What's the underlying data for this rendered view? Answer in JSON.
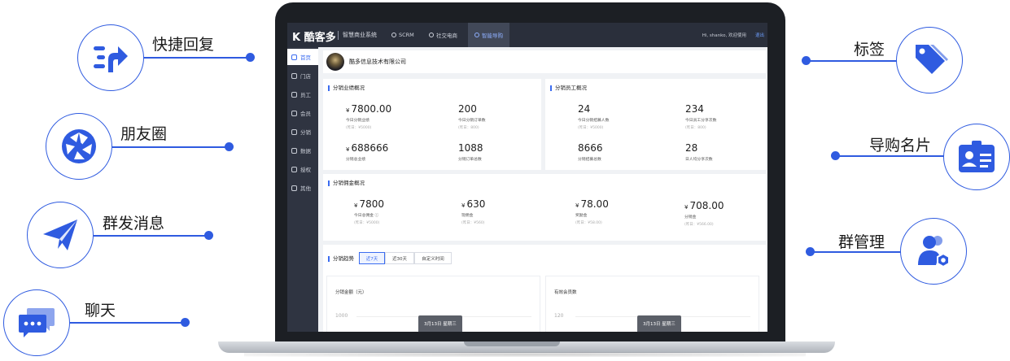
{
  "features": {
    "quick_reply": "快捷回复",
    "moments": "朋友圈",
    "mass_message": "群发消息",
    "chat": "聊天",
    "tags": "标签",
    "guide_card": "导购名片",
    "group_manage": "群管理"
  },
  "colors": {
    "accent": "#2f5be0",
    "topbar": "#2a2f3b",
    "sidebar": "#2f3441",
    "link": "#3b6cf0"
  },
  "app": {
    "logo": "酷客多",
    "system_name": "智慧商业系统",
    "nav": [
      {
        "label": "SCRM",
        "icon": "scrm-icon"
      },
      {
        "label": "社交电商",
        "icon": "shop-icon"
      },
      {
        "label": "智能导购",
        "icon": "guide-icon"
      }
    ],
    "welcome": "Hi, shanko, 欢迎使用",
    "logout": "退出"
  },
  "sidebar": [
    {
      "label": "首页",
      "icon": "home-icon"
    },
    {
      "label": "门店",
      "icon": "store-icon"
    },
    {
      "label": "员工",
      "icon": "staff-icon"
    },
    {
      "label": "会员",
      "icon": "member-icon"
    },
    {
      "label": "分销",
      "icon": "distribution-icon"
    },
    {
      "label": "数据",
      "icon": "data-icon"
    },
    {
      "label": "授权",
      "icon": "auth-icon"
    },
    {
      "label": "其他",
      "icon": "other-icon"
    }
  ],
  "company_name": "酷多信息技术有限公司",
  "performance": {
    "title": "分销业绩概况",
    "stats": [
      {
        "value": "7800.00",
        "currency": "¥",
        "label": "今日分销业绩",
        "sub": "(昨日：¥5000)"
      },
      {
        "value": "200",
        "currency": "",
        "label": "今日分销订单数",
        "sub": "(昨日：800)"
      },
      {
        "value": "688666",
        "currency": "¥",
        "label": "分销总业绩",
        "sub": ""
      },
      {
        "value": "1088",
        "currency": "",
        "label": "分销订单总数",
        "sub": ""
      }
    ]
  },
  "staff": {
    "title": "分销员工概况",
    "stats": [
      {
        "value": "24",
        "label": "今日分销招募人数",
        "sub": "(昨日：¥5000)"
      },
      {
        "value": "234",
        "label": "今日员工分享次数",
        "sub": "(昨日：800)"
      },
      {
        "value": "8666",
        "label": "分销招募总数",
        "sub": ""
      },
      {
        "value": "28",
        "label": "日人均分享次数",
        "sub": ""
      }
    ]
  },
  "commission": {
    "title": "分销佣金概况",
    "stats": [
      {
        "value": "7800",
        "currency": "¥",
        "label": "今日总佣金 ⓘ",
        "sub": "(昨日：¥5000)"
      },
      {
        "value": "630",
        "currency": "¥",
        "label": "现佣金",
        "sub": "(昨日：¥560)"
      },
      {
        "value": "78.00",
        "currency": "¥",
        "label": "奖励金",
        "sub": "(昨日：¥58.00)"
      },
      {
        "value": "708.00",
        "currency": "¥",
        "label": "分销金",
        "sub": "(昨日：¥566.00)"
      }
    ]
  },
  "trend": {
    "title": "分销趋势",
    "ranges": [
      "近7天",
      "近30天",
      "自定义时间"
    ],
    "active_range": "近7天",
    "charts": [
      {
        "title": "分销金额（元）",
        "tick": "1000",
        "tooltip": "3月13日 星期三"
      },
      {
        "title": "有效会员数",
        "tick": "120",
        "tooltip": "3月13日 星期三"
      }
    ]
  }
}
